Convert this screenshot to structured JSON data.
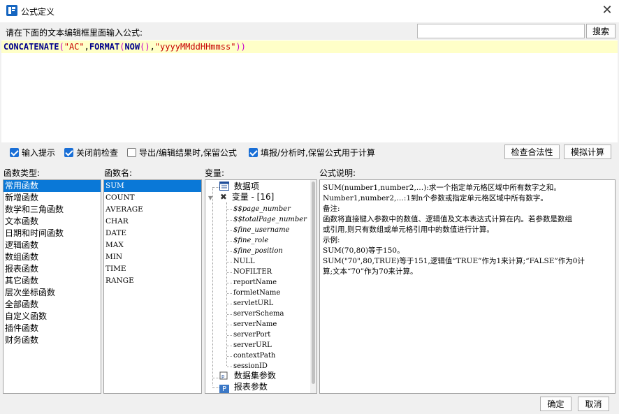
{
  "window": {
    "title": "公式定义",
    "close": "✕"
  },
  "prompt": "请在下面的文本编辑框里面输入公式:",
  "search": {
    "value": "",
    "placeholder": "",
    "button": "搜索"
  },
  "formula": {
    "tokens": [
      {
        "t": "CONCATENATE",
        "k": "fn"
      },
      {
        "t": "(",
        "k": "paren"
      },
      {
        "t": "\"AC\"",
        "k": "str"
      },
      {
        "t": ",",
        "k": "punc"
      },
      {
        "t": "FORMAT",
        "k": "fn"
      },
      {
        "t": "(",
        "k": "paren"
      },
      {
        "t": "NOW",
        "k": "fn"
      },
      {
        "t": "()",
        "k": "paren"
      },
      {
        "t": ",",
        "k": "punc"
      },
      {
        "t": "\"yyyyMMddHHmmss\"",
        "k": "str"
      },
      {
        "t": "))",
        "k": "paren"
      }
    ]
  },
  "options": [
    {
      "label": "输入提示",
      "checked": true
    },
    {
      "label": "关闭前检查",
      "checked": true
    },
    {
      "label": "导出/编辑结果时,保留公式",
      "checked": false
    },
    {
      "label": "填报/分析时,保留公式用于计算",
      "checked": true
    }
  ],
  "buttons": {
    "check": "检查合法性",
    "simulate": "模拟计算",
    "ok": "确定",
    "cancel": "取消"
  },
  "labels": {
    "func_type": "函数类型:",
    "func_name": "函数名:",
    "variable": "变量:",
    "description": "公式说明:"
  },
  "func_types": [
    "常用函数",
    "新增函数",
    "数学和三角函数",
    "文本函数",
    "日期和时间函数",
    "逻辑函数",
    "数组函数",
    "报表函数",
    "其它函数",
    "层次坐标函数",
    "全部函数",
    "自定义函数",
    "插件函数",
    "财务函数"
  ],
  "func_names": [
    "SUM",
    "COUNT",
    "AVERAGE",
    "CHAR",
    "DATE",
    "MAX",
    "MIN",
    "TIME",
    "RANGE"
  ],
  "variables": {
    "dataset": "数据项",
    "var_group": "变量 - [16]",
    "items": [
      {
        "name": "$$page_number",
        "italic": true
      },
      {
        "name": "$$totalPage_number",
        "italic": true
      },
      {
        "name": "$fine_username",
        "italic": true
      },
      {
        "name": "$fine_role",
        "italic": true
      },
      {
        "name": "$fine_position",
        "italic": true
      },
      {
        "name": "NULL",
        "italic": false
      },
      {
        "name": "NOFILTER",
        "italic": false
      },
      {
        "name": "reportName",
        "italic": false
      },
      {
        "name": "formletName",
        "italic": false
      },
      {
        "name": "servletURL",
        "italic": false
      },
      {
        "name": "serverSchema",
        "italic": false
      },
      {
        "name": "serverName",
        "italic": false
      },
      {
        "name": "serverPort",
        "italic": false
      },
      {
        "name": "serverURL",
        "italic": false
      },
      {
        "name": "contextPath",
        "italic": false
      },
      {
        "name": "sessionID",
        "italic": false
      }
    ],
    "dataset_params": "数据集参数",
    "report_params": "报表参数"
  },
  "description_lines": [
    "SUM(number1,number2,…):求一个指定单元格区域中所有数字之和。",
    "Number1,number2,…:1到n个参数或指定单元格区域中所有数字。",
    "备注:",
    "函数将直接键入参数中的数值、逻辑值及文本表达式计算在内。若参数是数组",
    "或引用,则只有数组或单元格引用中的数值进行计算。",
    "示例:",
    "SUM(70,80)等于150。",
    "SUM(\"70\",80,TRUE)等于151,逻辑值“TRUE”作为1来计算;“FALSE”作为0计",
    "算;文本“70”作为70来计算。"
  ],
  "colors": {
    "selection": "#0a78d7",
    "editor_highlight": "#ffffc8",
    "func": "#00008b",
    "string": "#c80000",
    "paren": "#c800c8"
  }
}
